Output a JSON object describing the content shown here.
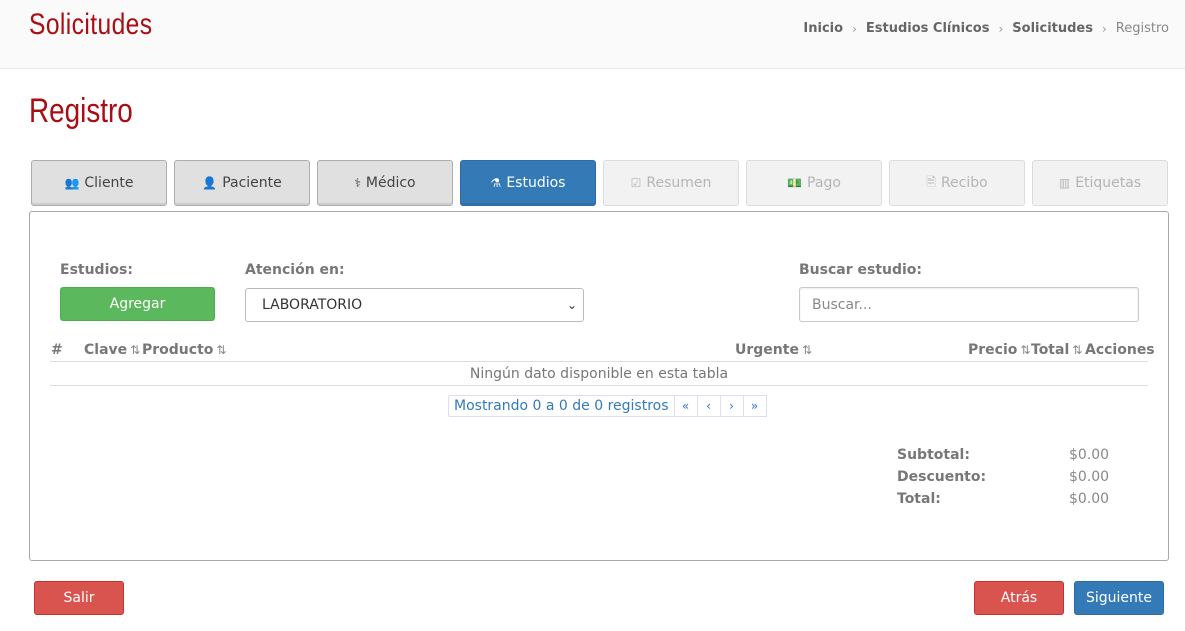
{
  "header": {
    "app_title": "Solicitudes",
    "breadcrumb": [
      {
        "label": "Inicio"
      },
      {
        "label": "Estudios Clínicos"
      },
      {
        "label": "Solicitudes"
      },
      {
        "label": "Registro"
      }
    ],
    "separator": "›"
  },
  "page_title": "Registro",
  "wizard_tabs": [
    {
      "label": "Cliente",
      "icon": "users-icon",
      "glyph": "👥",
      "state": "enabled"
    },
    {
      "label": "Paciente",
      "icon": "user-icon",
      "glyph": "👤",
      "state": "enabled"
    },
    {
      "label": "Médico",
      "icon": "user-md-icon",
      "glyph": "⚕",
      "state": "enabled"
    },
    {
      "label": "Estudios",
      "icon": "flask-icon",
      "glyph": "⚗",
      "state": "active"
    },
    {
      "label": "Resumen",
      "icon": "check-square-icon",
      "glyph": "☑",
      "state": "disabled"
    },
    {
      "label": "Pago",
      "icon": "money-icon",
      "glyph": "💵",
      "state": "disabled"
    },
    {
      "label": "Recibo",
      "icon": "file-text-icon",
      "glyph": "🗎",
      "state": "disabled"
    },
    {
      "label": "Etiquetas",
      "icon": "barcode-icon",
      "glyph": "▥",
      "state": "disabled"
    }
  ],
  "form": {
    "estudios_label": "Estudios:",
    "add_button": "Agregar",
    "atencion_label": "Atención en:",
    "atencion_value": "LABORATORIO",
    "search_label": "Buscar estudio:",
    "search_placeholder": "Buscar..."
  },
  "table": {
    "columns": [
      "#",
      "Clave",
      "Producto",
      "Urgente",
      "Precio",
      "Total",
      "Acciones"
    ],
    "sort_glyph": "⇅",
    "empty_message": "Ningún dato disponible en esta tabla",
    "pagination_info": "Mostrando 0 a 0 de 0 registros",
    "pager_buttons": [
      "«",
      "‹",
      "›",
      "»"
    ]
  },
  "totals": [
    {
      "label": "Subtotal:",
      "value": "$0.00"
    },
    {
      "label": "Descuento:",
      "value": "$0.00"
    },
    {
      "label": "Total:",
      "value": "$0.00"
    }
  ],
  "footer": {
    "exit_button": "Salir",
    "back_button": "Atrás",
    "next_button": "Siguiente"
  },
  "colors": {
    "brand_red": "#a80e14",
    "primary_blue": "#337ab7",
    "success_green": "#5cb85c",
    "danger_red": "#d9534f"
  }
}
